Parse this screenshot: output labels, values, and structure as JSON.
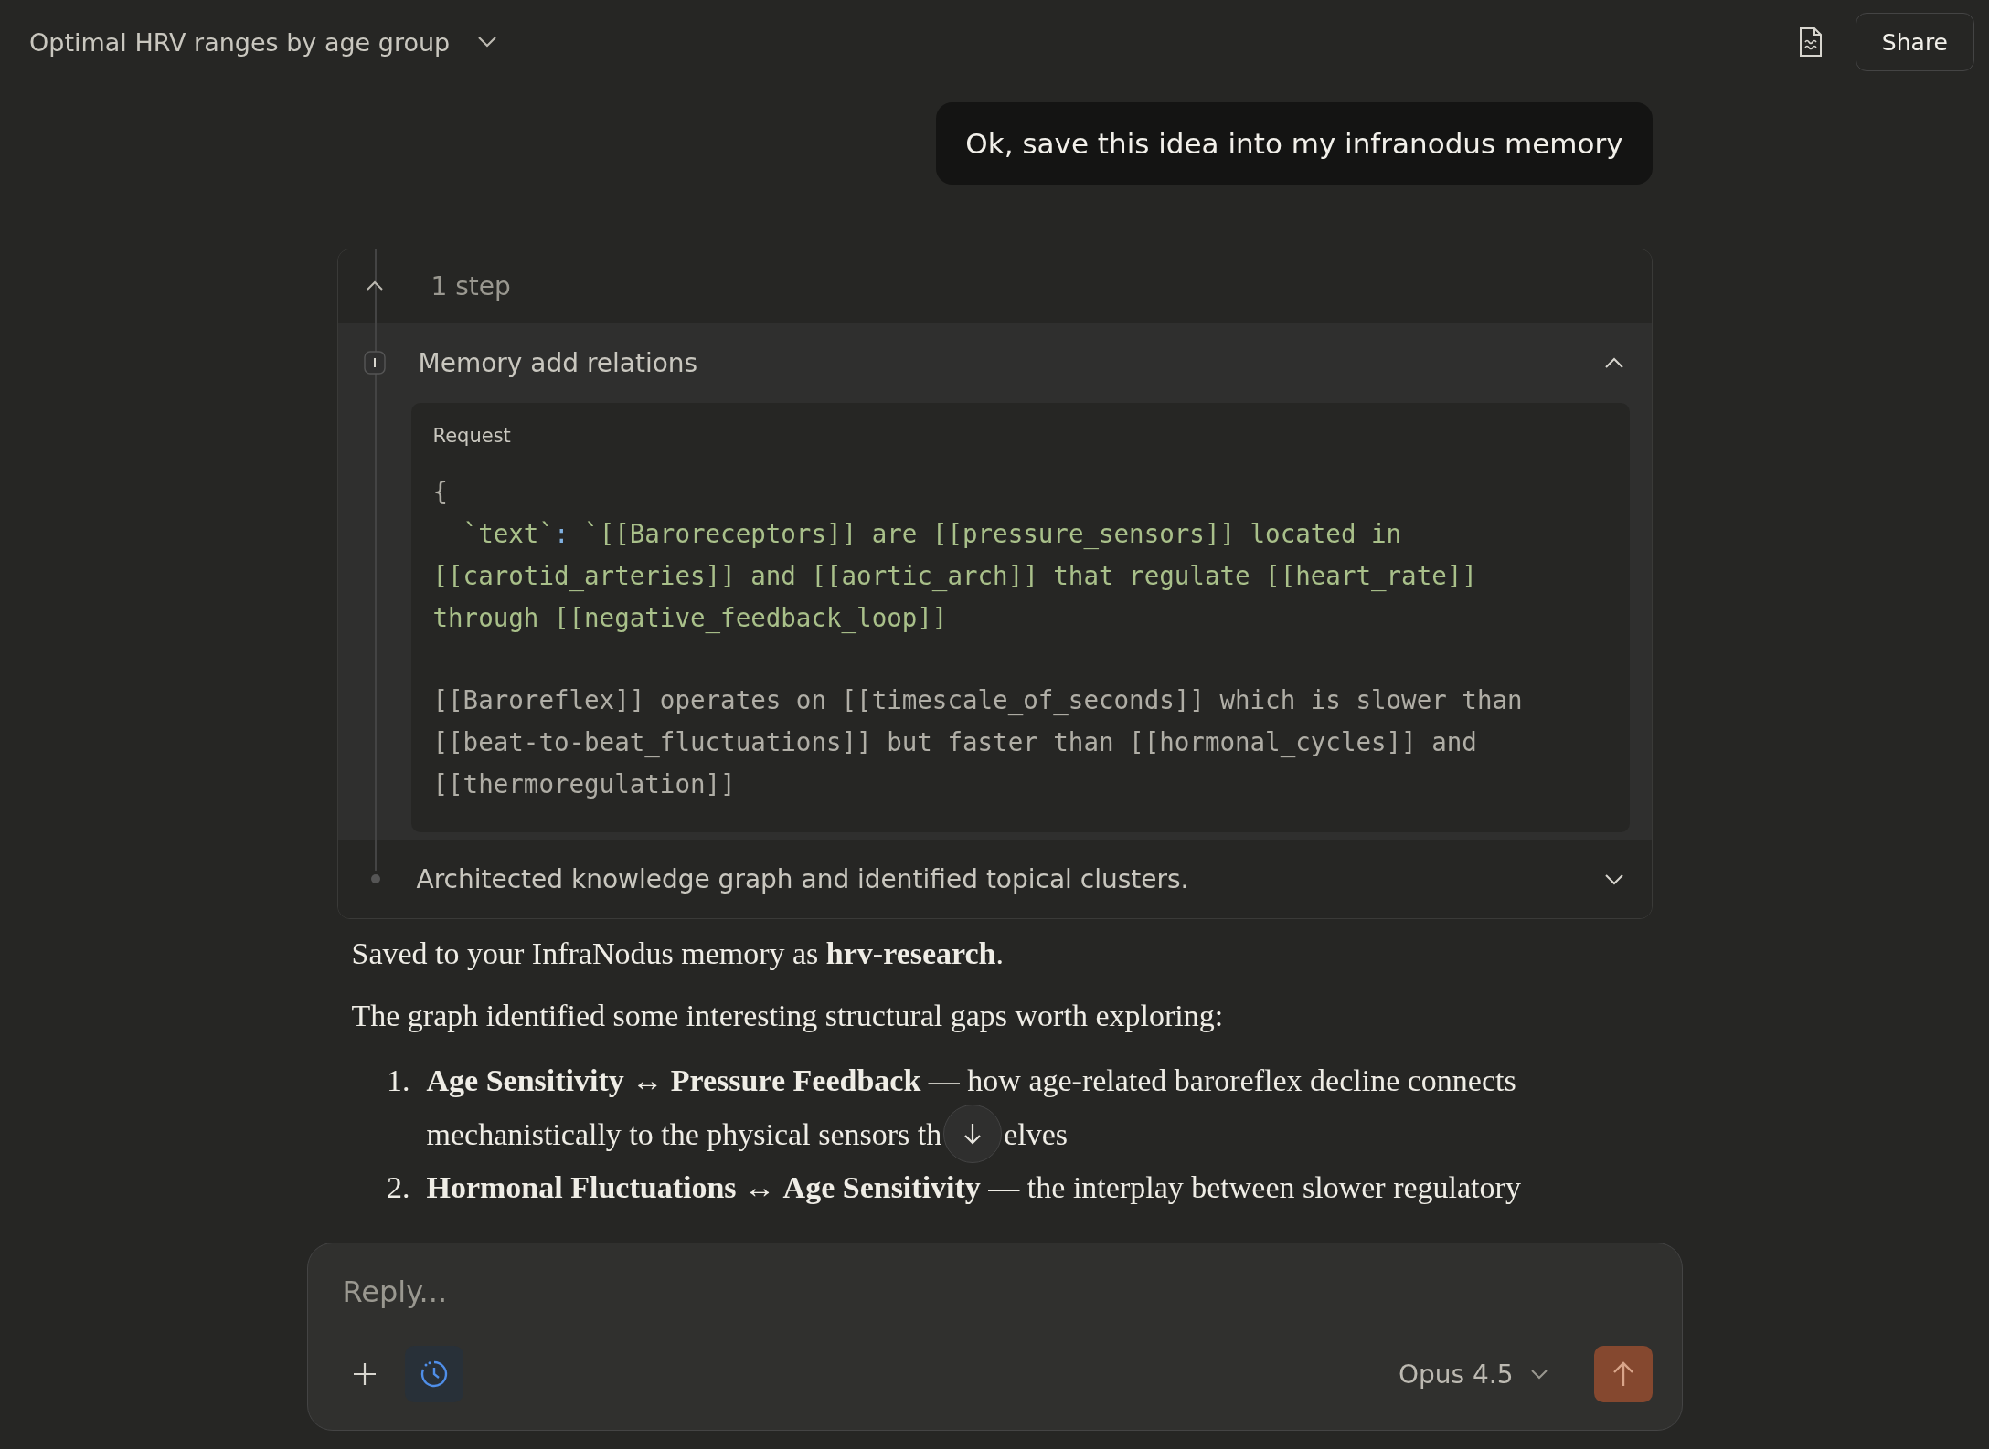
{
  "header": {
    "title": "Optimal HRV ranges by age group",
    "share_label": "Share"
  },
  "user_message": "Ok, save this idea into my infranodus memory",
  "steps": {
    "summary": "1 step",
    "expanded": true,
    "tool_call": {
      "title": "Memory add relations",
      "expanded": true,
      "request_label": "Request",
      "code": [
        {
          "lines": [
            [
              {
                "kind": "plain",
                "text": "{"
              }
            ],
            [
              {
                "kind": "string",
                "text": "  `text`"
              },
              {
                "kind": "punct",
                "text": ": "
              },
              {
                "kind": "string",
                "text": "`[[Baroreceptors]] are [[pressure_sensors]] located in"
              }
            ],
            [
              {
                "kind": "string",
                "text": "[[carotid_arteries]] and [[aortic_arch]] that regulate [[heart_rate]]"
              }
            ],
            [
              {
                "kind": "string",
                "text": "through [[negative_feedback_loop]]"
              }
            ]
          ]
        },
        {
          "lines": [
            [
              {
                "kind": "plain",
                "text": "[[Baroreflex]] operates on [[timescale_of_seconds]] which is slower than"
              }
            ],
            [
              {
                "kind": "plain",
                "text": "[[beat-to-beat_fluctuations]] but faster than [[hormonal_cycles]] and"
              }
            ],
            [
              {
                "kind": "plain",
                "text": "[[thermoregulation]]"
              }
            ]
          ]
        }
      ]
    },
    "thought": {
      "text": "Architected knowledge graph and identified topical clusters.",
      "expanded": false
    }
  },
  "response": {
    "paragraphs": [
      "Saved to your InfraNodus memory as **hrv-research**.",
      "The graph identified some interesting structural gaps worth exploring:"
    ],
    "list": [
      {
        "number": "1.",
        "text": "**Age Sensitivity** ↔ **Pressure Feedback** — how age-related baroreflex decline connects",
        "continuation": "mechanistically to the physical sensors th",
        "text_after_button": "elves"
      },
      {
        "number": "2.",
        "text": "**Hormonal Fluctuations** ↔ **Age Sensitivity** — the interplay between slower regulatory"
      }
    ]
  },
  "composer": {
    "placeholder": "Reply...",
    "model": "Opus 4.5"
  }
}
